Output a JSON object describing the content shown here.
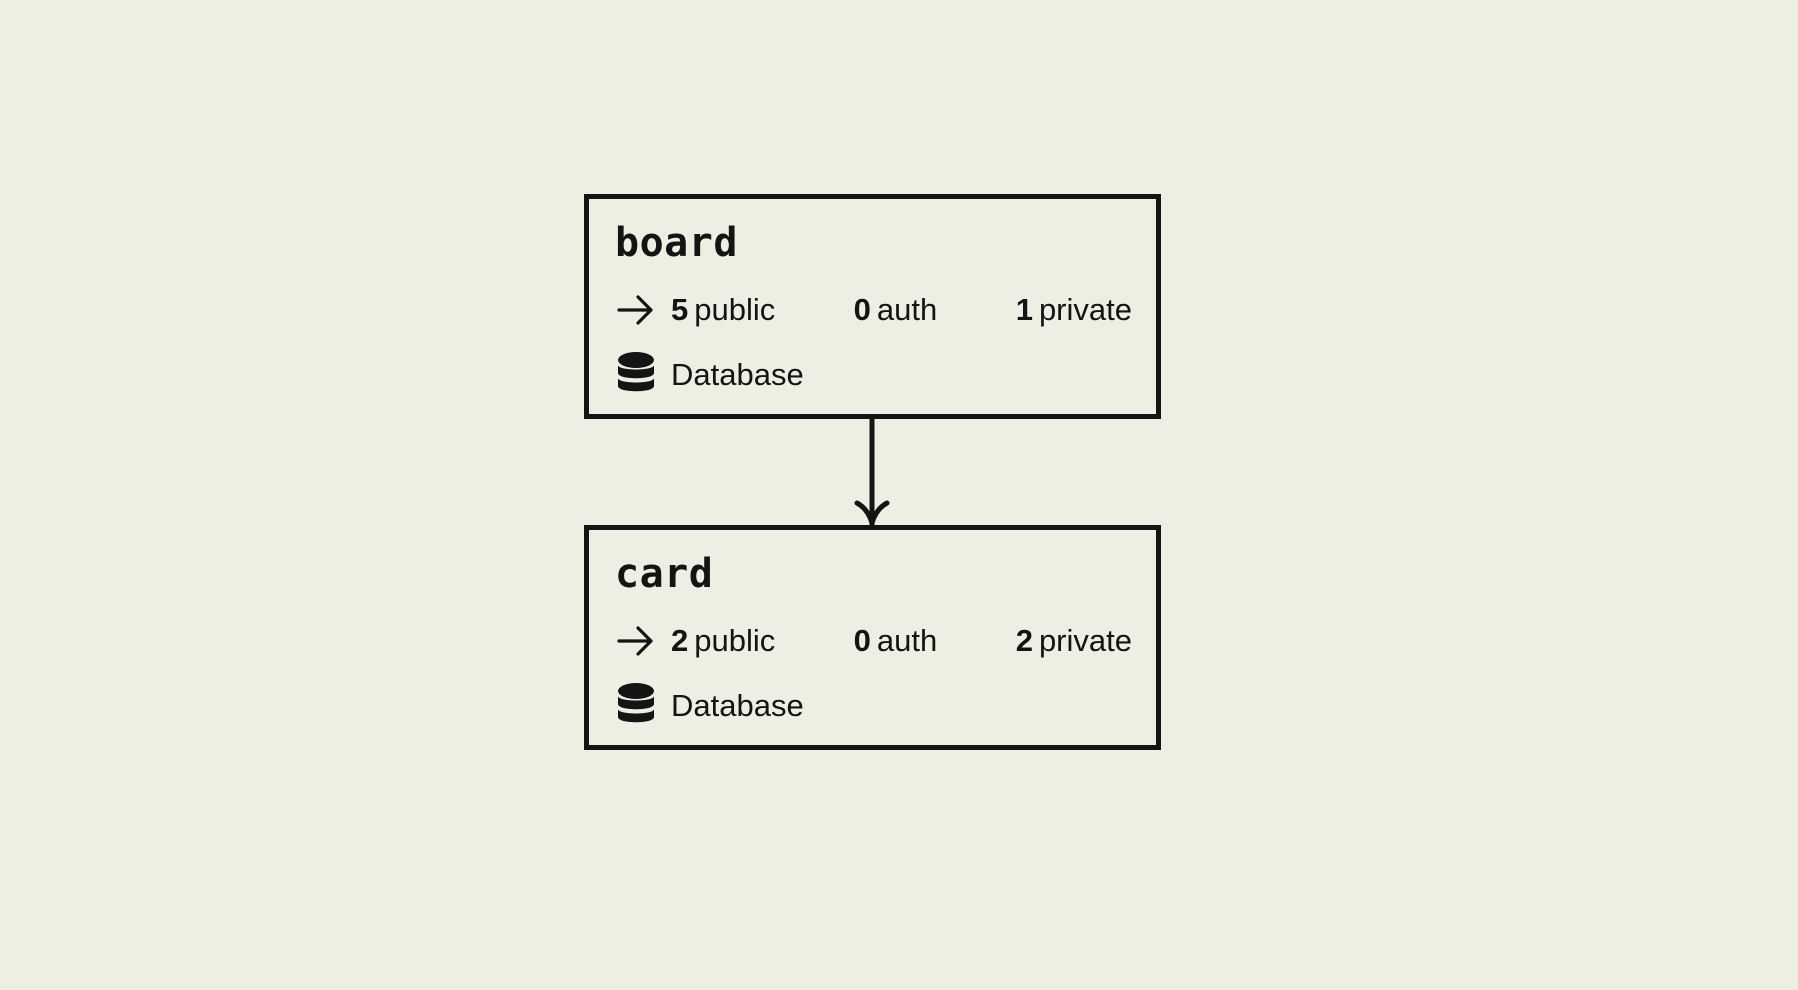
{
  "colors": {
    "background": "#EEEEE2",
    "ink": "#141414"
  },
  "nodes": [
    {
      "name": "board",
      "stats": {
        "public": {
          "count": "5",
          "label": "public"
        },
        "auth": {
          "count": "0",
          "label": "auth"
        },
        "private": {
          "count": "1",
          "label": "private"
        }
      },
      "stats_icon": "arrow-right-icon",
      "storage": {
        "icon": "database-icon",
        "label": "Database"
      }
    },
    {
      "name": "card",
      "stats": {
        "public": {
          "count": "2",
          "label": "public"
        },
        "auth": {
          "count": "0",
          "label": "auth"
        },
        "private": {
          "count": "2",
          "label": "private"
        }
      },
      "stats_icon": "arrow-right-icon",
      "storage": {
        "icon": "database-icon",
        "label": "Database"
      }
    }
  ],
  "edges": [
    {
      "from": "board",
      "to": "card",
      "type": "one-to-many"
    }
  ]
}
